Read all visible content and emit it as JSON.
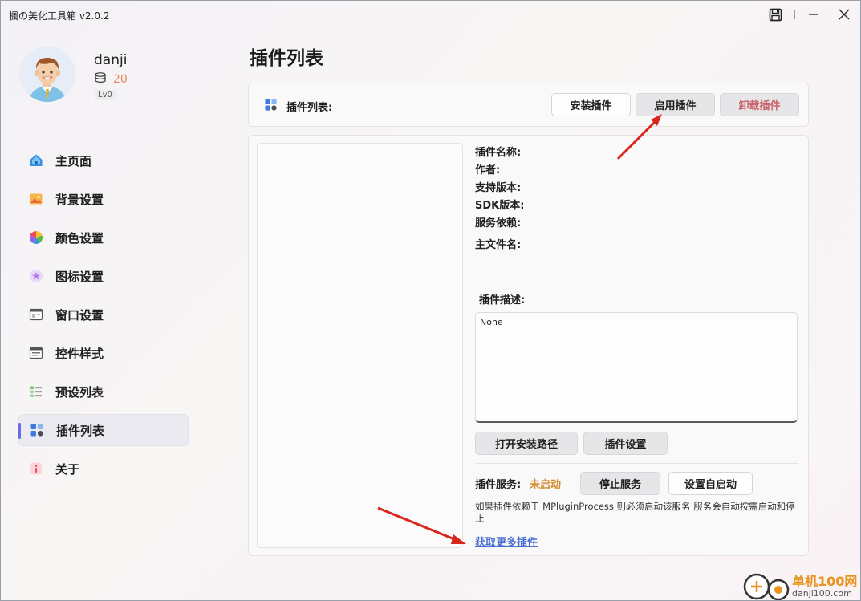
{
  "window": {
    "title": "楓の美化工具箱 v2.0.2"
  },
  "profile": {
    "username": "danji",
    "coins": "20",
    "level": "Lv0"
  },
  "sidebar": {
    "items": [
      {
        "label": "主页面",
        "icon": "home-icon"
      },
      {
        "label": "背景设置",
        "icon": "image-icon"
      },
      {
        "label": "颜色设置",
        "icon": "color-wheel-icon"
      },
      {
        "label": "图标设置",
        "icon": "star-icon"
      },
      {
        "label": "窗口设置",
        "icon": "window-icon"
      },
      {
        "label": "控件样式",
        "icon": "control-icon"
      },
      {
        "label": "预设列表",
        "icon": "list-icon"
      },
      {
        "label": "插件列表",
        "icon": "plugin-icon",
        "active": true
      },
      {
        "label": "关于",
        "icon": "info-icon"
      }
    ]
  },
  "main": {
    "title": "插件列表",
    "toolbar": {
      "label": "插件列表:",
      "install": "安装插件",
      "enable": "启用插件",
      "uninstall": "卸载插件"
    },
    "details": {
      "name": "插件名称:",
      "author": "作者:",
      "support_version": "支持版本:",
      "sdk_version": "SDK版本:",
      "service_dep": "服务依赖:",
      "main_file": "主文件名:",
      "desc_label": "插件描述:",
      "desc_value": "None"
    },
    "actions": {
      "open_path": "打开安装路径",
      "settings": "插件设置"
    },
    "service": {
      "label": "插件服务:",
      "status": "未启动",
      "stop": "停止服务",
      "autostart": "设置自启动",
      "hint": "如果插件依赖于 MPluginProcess 则必须启动该服务 服务会自动按需启动和停止"
    },
    "more_link": "获取更多插件"
  },
  "watermark": {
    "text": "单机100网",
    "url": "danji100.com"
  },
  "colors": {
    "accent": "#6a6ce8",
    "danger": "#c9636a",
    "warning": "#d18a2c",
    "link": "#4a6fd1"
  }
}
